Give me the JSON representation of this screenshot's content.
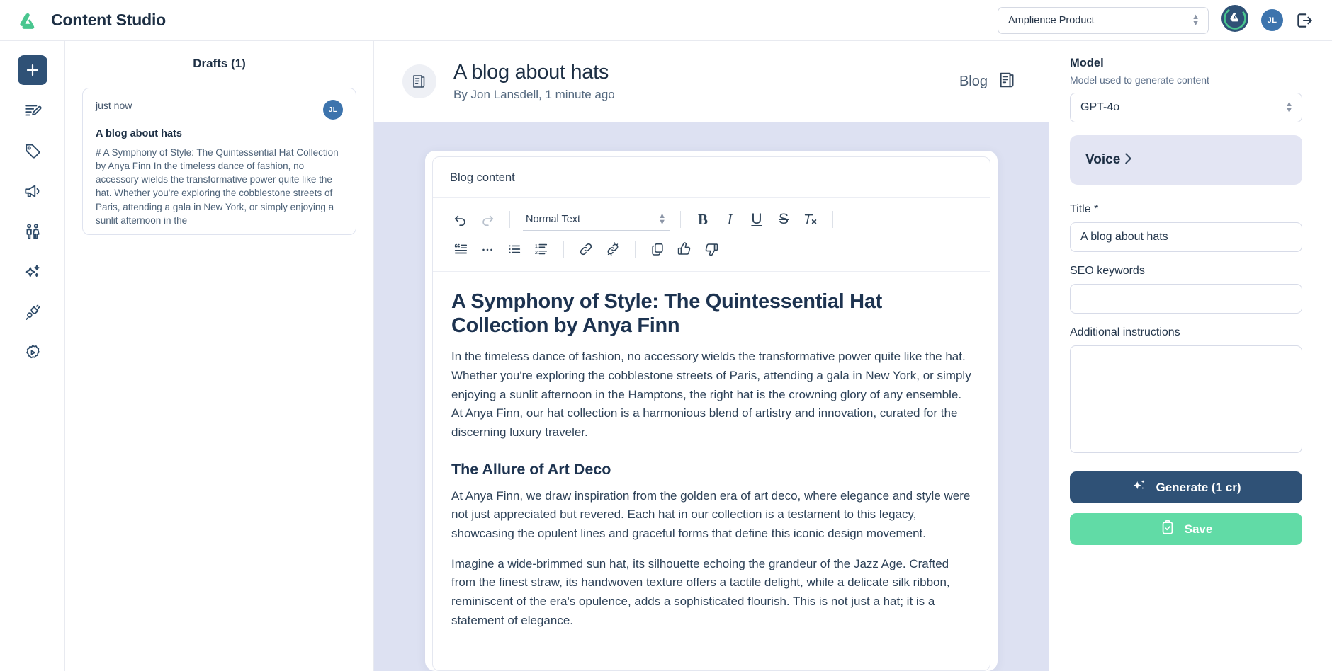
{
  "header": {
    "brand_title": "Content Studio",
    "logo_icon": "amplience-logo-icon",
    "product_select_value": "Amplience Product",
    "ring_avatar_icon": "amplience-ring-avatar-icon",
    "user_initials": "JL",
    "logout_icon": "logout-icon"
  },
  "sidebar": {
    "items": [
      {
        "name": "new",
        "icon": "plus-icon",
        "active": true
      },
      {
        "name": "write",
        "icon": "edit-document-icon",
        "active": false
      },
      {
        "name": "tags",
        "icon": "tag-icon",
        "active": false
      },
      {
        "name": "campaigns",
        "icon": "megaphone-icon",
        "active": false
      },
      {
        "name": "audiences",
        "icon": "people-icon",
        "active": false
      },
      {
        "name": "ai",
        "icon": "sparkle-icon",
        "active": false
      },
      {
        "name": "integrations",
        "icon": "plug-icon",
        "active": false
      },
      {
        "name": "settings",
        "icon": "gear-play-icon",
        "active": false
      }
    ]
  },
  "drafts": {
    "title": "Drafts (1)",
    "cards": [
      {
        "time": "just now",
        "initials": "JL",
        "heading": "A blog about hats",
        "excerpt": "# A Symphony of Style: The Quintessential Hat Collection by Anya Finn In the timeless dance of fashion, no accessory wields the transformative power quite like the hat. Whether you're exploring the cobblestone streets of Paris, attending a gala in New York, or simply enjoying a sunlit afternoon in the"
      }
    ]
  },
  "document": {
    "icon": "document-blog-icon",
    "title": "A blog about hats",
    "byline": "By Jon Lansdell, 1 minute ago",
    "type_label": "Blog",
    "type_icon": "blog-icon"
  },
  "editor": {
    "field_label": "Blog content",
    "toolbar": {
      "undo_icon": "undo-icon",
      "redo_icon": "redo-icon",
      "style_value": "Normal Text",
      "bold": "B",
      "italic": "I",
      "underline": "U",
      "strikethrough": "S",
      "clear_format": "Tx",
      "quote_icon": "blockquote-icon",
      "more_icon": "ellipsis-icon",
      "bullet_list_icon": "bullet-list-icon",
      "numbered_list_icon": "numbered-list-icon",
      "link_icon": "link-icon",
      "unlink_icon": "unlink-icon",
      "copy_icon": "copy-icon",
      "thumbs_up_icon": "thumbs-up-icon",
      "thumbs_down_icon": "thumbs-down-icon"
    },
    "article": {
      "h1": "A Symphony of Style: The Quintessential Hat Collection by Anya Finn",
      "p1": "In the timeless dance of fashion, no accessory wields the transformative power quite like the hat. Whether you're exploring the cobblestone streets of Paris, attending a gala in New York, or simply enjoying a sunlit afternoon in the Hamptons, the right hat is the crowning glory of any ensemble. At Anya Finn, our hat collection is a harmonious blend of artistry and innovation, curated for the discerning luxury traveler.",
      "h2": "The Allure of Art Deco",
      "p2": "At Anya Finn, we draw inspiration from the golden era of art deco, where elegance and style were not just appreciated but revered. Each hat in our collection is a testament to this legacy, showcasing the opulent lines and graceful forms that define this iconic design movement.",
      "p3": "Imagine a wide-brimmed sun hat, its silhouette echoing the grandeur of the Jazz Age. Crafted from the finest straw, its handwoven texture offers a tactile delight, while a delicate silk ribbon, reminiscent of the era's opulence, adds a sophisticated flourish. This is not just a hat; it is a statement of elegance."
    }
  },
  "panel": {
    "model_label": "Model",
    "model_help": "Model used to generate content",
    "model_value": "GPT-4o",
    "voice_label": "Voice",
    "voice_chevron_icon": "chevron-right-icon",
    "title_label": "Title *",
    "title_value": "A blog about hats",
    "seo_label": "SEO keywords",
    "seo_value": "",
    "instructions_label": "Additional instructions",
    "instructions_value": "",
    "generate_label": "Generate (1 cr)",
    "generate_icon": "sparkle-icon",
    "save_label": "Save",
    "save_icon": "clipboard-check-icon"
  },
  "colors": {
    "brand_green": "#49c68f",
    "navy": "#2f5176",
    "avatar_blue": "#3d74ad",
    "save_green": "#61dba6",
    "canvas": "#dde1f2",
    "voice_bg": "#e3e5f3"
  }
}
